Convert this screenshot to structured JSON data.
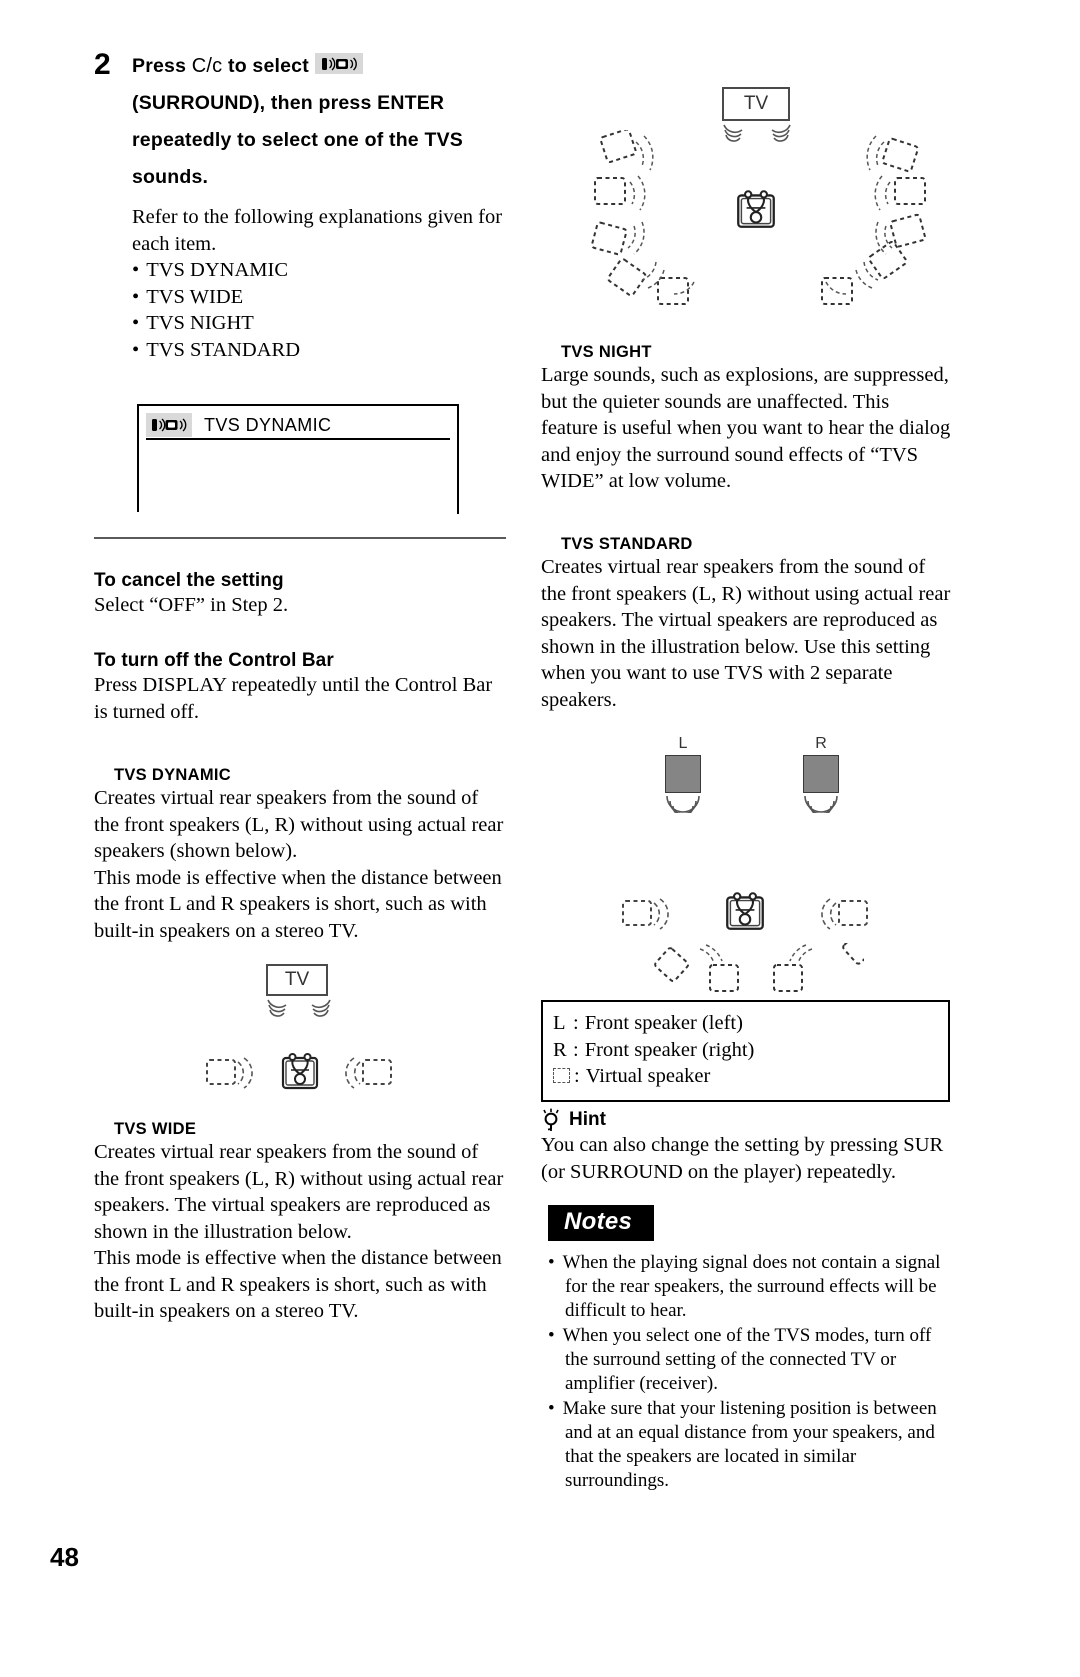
{
  "page": {
    "number": "48"
  },
  "step": {
    "number": "2",
    "head_line1_a": "Press",
    "head_line1_cc": "C/c",
    "head_line1_b": "to select",
    "head_line2": "(SURROUND), then press ENTER",
    "head_line3": "repeatedly to select one of the TVS",
    "head_line4": "sounds.",
    "sub": "Refer to the following explanations given for each item.",
    "items": [
      "TVS DYNAMIC",
      "TVS WIDE",
      "TVS NIGHT",
      "TVS STANDARD"
    ]
  },
  "osd": {
    "icon": "surround-icon",
    "label": "TVS DYNAMIC"
  },
  "left": {
    "cancel": {
      "heading": "To cancel the setting",
      "body": "Select “OFF” in Step 2."
    },
    "control_bar": {
      "heading": "To turn off the Control Bar",
      "body": "Press DISPLAY repeatedly until the Control Bar is turned off."
    },
    "tvs_dynamic": {
      "heading": "TVS DYNAMIC",
      "body": "Creates virtual rear speakers from the sound of the front speakers (L, R) without using actual rear speakers (shown below).\nThis mode is effective when the distance between the front L and R speakers is short, such as with built-in speakers on a stereo TV."
    },
    "tvs_wide": {
      "heading": "TVS WIDE",
      "body": "Creates virtual rear speakers from the sound of the front speakers (L, R) without using actual rear speakers. The virtual speakers are reproduced as shown in the illustration below.\nThis mode is effective when the distance between the front L and R speakers is short, such as with built-in speakers on a stereo TV."
    },
    "figure_dynamic": {
      "tv_label": "TV"
    }
  },
  "right": {
    "figure_wide": {
      "tv_label": "TV"
    },
    "tvs_night": {
      "heading": "TVS NIGHT",
      "body": "Large sounds, such as explosions, are suppressed, but the quieter sounds are unaffected. This feature is useful when you want to hear the dialog and enjoy the surround sound effects of “TVS WIDE” at low volume."
    },
    "tvs_standard": {
      "heading": "TVS STANDARD",
      "body": "Creates virtual rear speakers from the sound of the front speakers (L, R) without using actual rear speakers. The virtual speakers are reproduced as shown in the illustration below. Use this setting when you want to use TVS with 2 separate speakers."
    },
    "figure_standard": {
      "left_label": "L",
      "right_label": "R"
    },
    "legend": [
      {
        "key": "L",
        "sep": ":",
        "text": "Front speaker (left)"
      },
      {
        "key": "R",
        "sep": ":",
        "text": "Front speaker (right)"
      },
      {
        "key": "dashed-square-icon",
        "sep": ":",
        "text": "Virtual speaker"
      }
    ],
    "hint": {
      "icon": "lightbulb-icon",
      "heading": "Hint",
      "body": "You can also change the setting by pressing SUR (or SURROUND on the player) repeatedly."
    },
    "notes": {
      "badge": "Notes",
      "items": [
        "When the playing signal does not contain a signal for the rear speakers, the surround effects will be difficult to hear.",
        "When you select one of the TVS modes, turn off the surround setting of the connected TV or amplifier (receiver).",
        "Make sure that your listening position is between and at an equal distance from your speakers, and that the speakers are located in similar surroundings."
      ]
    }
  }
}
